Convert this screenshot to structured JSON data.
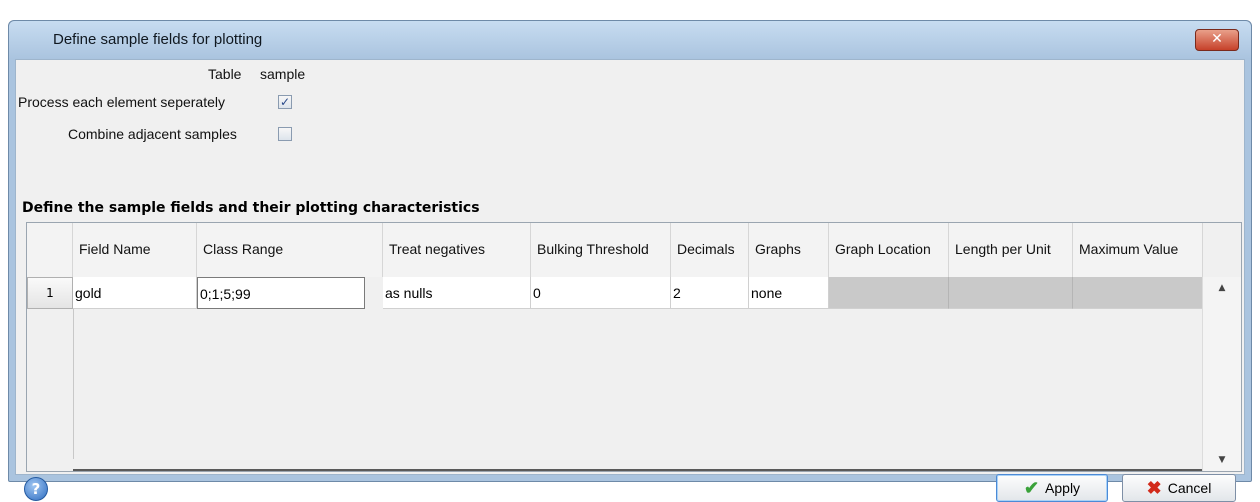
{
  "window": {
    "title": "Define sample fields for plotting",
    "close_glyph": "✕"
  },
  "form": {
    "table_label": "Table",
    "table_value": "sample",
    "process_label": "Process each element seperately",
    "process_checked": true,
    "combine_label": "Combine adjacent samples",
    "combine_checked": false
  },
  "section_title": "Define the sample fields and their plotting characteristics",
  "grid": {
    "columns": [
      "Field Name",
      "Class Range",
      "Treat negatives",
      "Bulking Threshold",
      "Decimals",
      "Graphs",
      "Graph Location",
      "Length per Unit",
      "Maximum Value"
    ],
    "rows": [
      {
        "num": "1",
        "cells": [
          "gold",
          "0;1;5;99",
          "as nulls",
          "0",
          "2",
          "none",
          "",
          "",
          ""
        ]
      }
    ]
  },
  "buttons": {
    "help": "?",
    "apply": "Apply",
    "cancel": "Cancel"
  },
  "icons": {
    "close": "close-icon",
    "help": "help-icon",
    "apply": "checkmark-icon",
    "cancel": "cancel-x-icon",
    "scroll_up": "arrow-up-icon",
    "scroll_down": "arrow-down-icon"
  }
}
